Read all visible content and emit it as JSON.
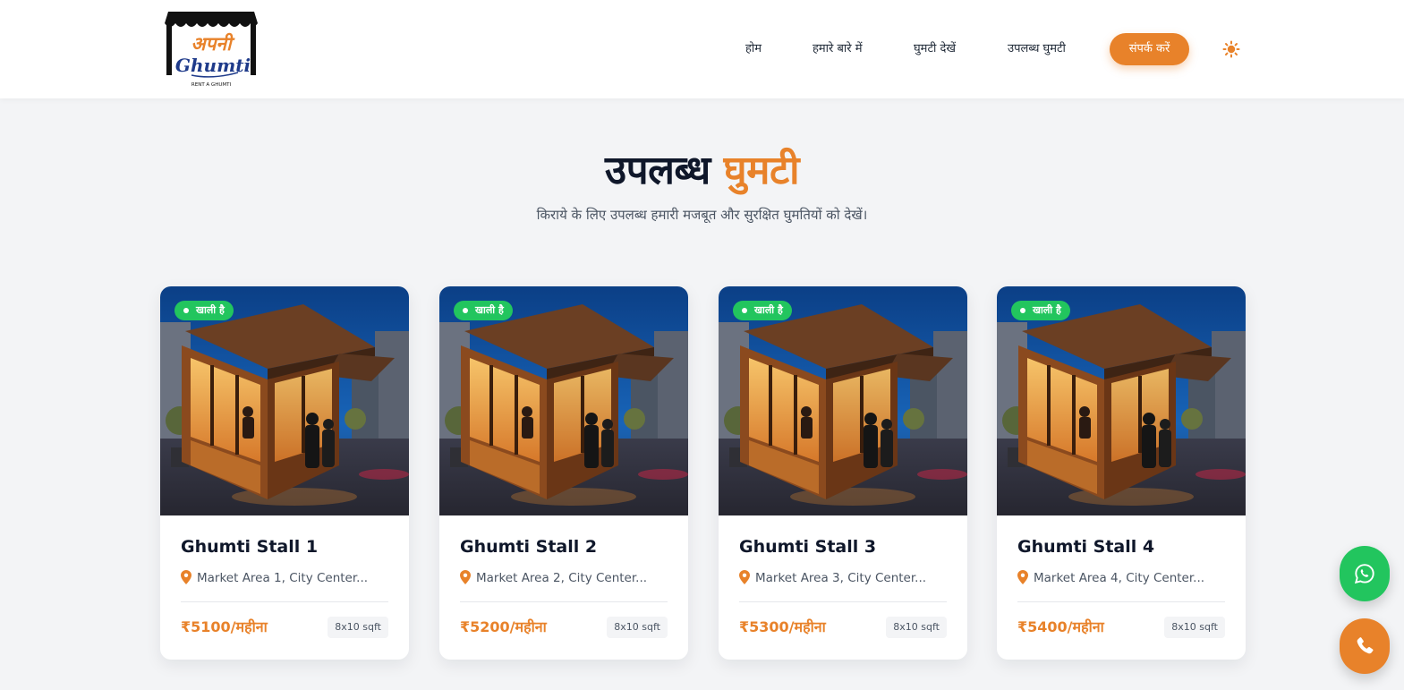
{
  "header": {
    "logo": {
      "top_text": "अपनी",
      "bottom_text": "Ghumti",
      "tagline": "RENT A GHUMTI"
    },
    "nav": [
      {
        "label": "होम"
      },
      {
        "label": "हमारे बारे में"
      },
      {
        "label": "घुमटी देखें"
      },
      {
        "label": "उपलब्ध घुमटी"
      }
    ],
    "cta_label": "संपर्क करें",
    "theme_icon": "sun-icon"
  },
  "section": {
    "title_part1": "उपलब्ध",
    "title_part2": "घुमटी",
    "subtitle": "किराये के लिए उपलब्ध हमारी मजबूत और सुरक्षित घुमतियों को देखें।"
  },
  "cards": [
    {
      "badge": "खाली है",
      "title": "Ghumti Stall 1",
      "location": "Market Area 1, City Center...",
      "price": "₹5100/महीना",
      "size": "8x10 sqft"
    },
    {
      "badge": "खाली है",
      "title": "Ghumti Stall 2",
      "location": "Market Area 2, City Center...",
      "price": "₹5200/महीना",
      "size": "8x10 sqft"
    },
    {
      "badge": "खाली है",
      "title": "Ghumti Stall 3",
      "location": "Market Area 3, City Center...",
      "price": "₹5300/महीना",
      "size": "8x10 sqft"
    },
    {
      "badge": "खाली है",
      "title": "Ghumti Stall 4",
      "location": "Market Area 4, City Center...",
      "price": "₹5400/महीना",
      "size": "8x10 sqft"
    }
  ],
  "colors": {
    "accent": "#e8822a",
    "success": "#22c55e",
    "text_dark": "#0f172a"
  },
  "floating": {
    "whatsapp_icon": "whatsapp-icon",
    "phone_icon": "phone-icon"
  }
}
